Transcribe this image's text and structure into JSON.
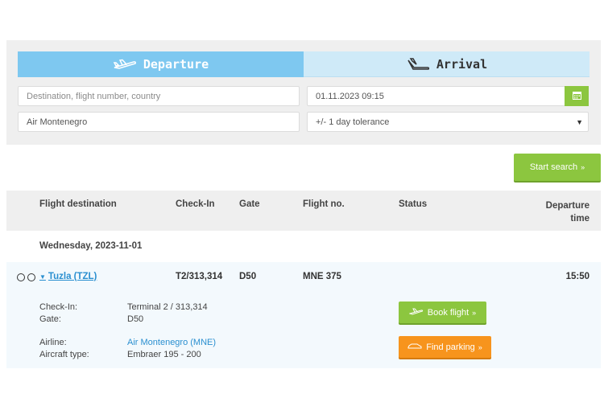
{
  "tabs": {
    "departure": "Departure",
    "arrival": "Arrival"
  },
  "search": {
    "destination_placeholder": "Destination, flight number, country",
    "date_value": "01.11.2023 09:15",
    "airline_value": "Air Montenegro",
    "tolerance_value": "+/- 1 day tolerance",
    "start_label": "Start search"
  },
  "table": {
    "headers": {
      "destination": "Flight destination",
      "checkin": "Check-In",
      "gate": "Gate",
      "flight_no": "Flight no.",
      "status": "Status",
      "departure_line1": "Departure",
      "departure_line2": "time"
    },
    "date_heading": "Wednesday, 2023-11-01",
    "flight": {
      "destination": "Tuzla (TZL)",
      "checkin": "T2/313,314",
      "gate": "D50",
      "flight_no": "MNE 375",
      "departure_time": "15:50"
    },
    "details": {
      "checkin_label": "Check-In:",
      "checkin_value": "Terminal 2 / 313,314",
      "gate_label": "Gate:",
      "gate_value": "D50",
      "airline_label": "Airline:",
      "airline_value": "Air Montenegro (MNE)",
      "aircraft_label": "Aircraft type:",
      "aircraft_value": "Embraer 195 - 200"
    },
    "actions": {
      "book": "Book flight",
      "parking": "Find parking"
    }
  },
  "colors": {
    "accent_green": "#8cc63f",
    "accent_orange": "#f7941d",
    "tab_active": "#7ec8f0",
    "link_blue": "#2a8fd0"
  }
}
